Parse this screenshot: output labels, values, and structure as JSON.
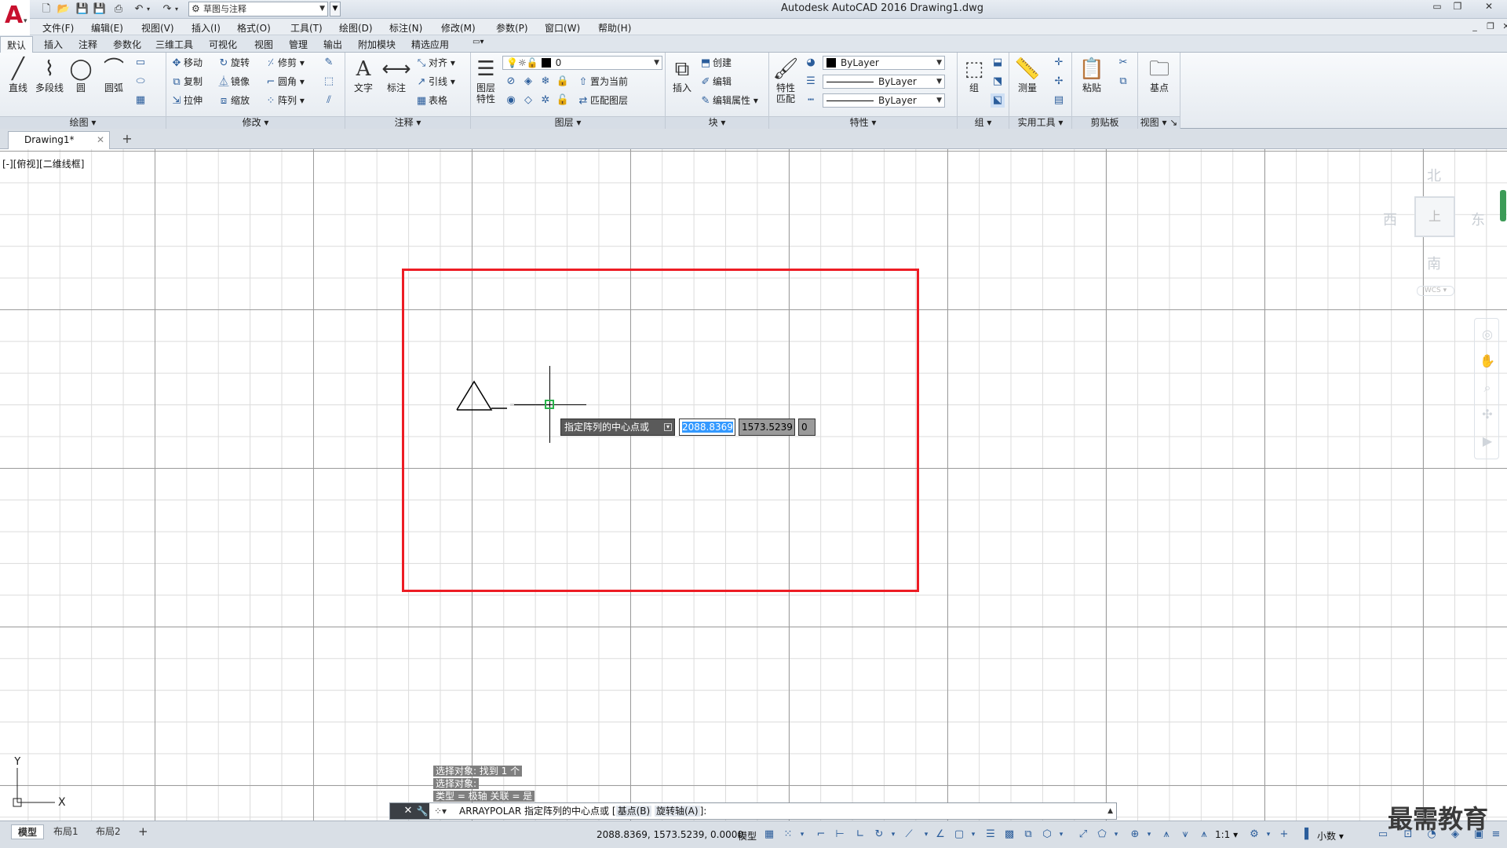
{
  "window": {
    "title": "Autodesk AutoCAD 2016    Drawing1.dwg",
    "workspace": "草图与注释"
  },
  "menu": [
    "文件(F)",
    "编辑(E)",
    "视图(V)",
    "插入(I)",
    "格式(O)",
    "工具(T)",
    "绘图(D)",
    "标注(N)",
    "修改(M)",
    "参数(P)",
    "窗口(W)",
    "帮助(H)"
  ],
  "ribbon_tabs": [
    "默认",
    "插入",
    "注释",
    "参数化",
    "三维工具",
    "可视化",
    "视图",
    "管理",
    "输出",
    "附加模块",
    "精选应用"
  ],
  "ribbon": {
    "draw": {
      "title": "绘图",
      "line": "直线",
      "polyline": "多段线",
      "circle": "圆",
      "arc": "圆弧"
    },
    "modify": {
      "title": "修改",
      "move": "移动",
      "rotate": "旋转",
      "trim": "修剪",
      "copy": "复制",
      "mirror": "镜像",
      "fillet": "圆角",
      "stretch": "拉伸",
      "scale": "缩放",
      "array": "阵列"
    },
    "annotation": {
      "title": "注释",
      "text": "文字",
      "dimension": "标注",
      "align": "对齐",
      "leader": "引线",
      "table": "表格"
    },
    "layers": {
      "title": "图层",
      "props_line1": "图层",
      "props_line2": "特性",
      "current_layer": "0",
      "make_current": "置为当前",
      "match_layer": "匹配图层"
    },
    "block": {
      "title": "块",
      "insert": "插入",
      "create": "创建",
      "edit": "编辑",
      "edit_attributes": "编辑属性"
    },
    "properties": {
      "title": "特性",
      "match_line1": "特性",
      "match_line2": "匹配",
      "color": "ByLayer",
      "linetype": "ByLayer",
      "lineweight": "ByLayer"
    },
    "groups": {
      "title": "组",
      "group": "组"
    },
    "utilities": {
      "title": "实用工具",
      "measure": "测量"
    },
    "clipboard": {
      "title": "剪贴板",
      "paste": "粘贴"
    },
    "view": {
      "title": "视图",
      "base": "基点"
    }
  },
  "document_tab": "Drawing1*",
  "viewport_label": "[-][俯视][二维线框]",
  "dynamic_input": {
    "prompt": "指定阵列的中心点或",
    "x": "2088.8369",
    "y": "1573.5239",
    "z": "0"
  },
  "viewcube": {
    "north": "北",
    "south": "南",
    "east": "东",
    "west": "西",
    "wcs": "WCS"
  },
  "ucs": {
    "x": "X",
    "y": "Y"
  },
  "command_history": [
    "选择对象: 找到 1 个",
    "选择对象:",
    "类型 = 极轴  关联 = 是"
  ],
  "command_line": {
    "command": "ARRAYPOLAR",
    "prompt": "指定阵列的中心点或",
    "bracket_open": "[",
    "option_base": "基点(B)",
    "option_axis": "旋转轴(A)",
    "bracket_close": "]:"
  },
  "layout_tabs": [
    "模型",
    "布局1",
    "布局2"
  ],
  "status": {
    "coordinates": "2088.8369, 1573.5239, 0.0000",
    "space": "模型",
    "annotation_scale": "1:1",
    "units": "小数"
  },
  "watermark": "最需教育",
  "colors": {
    "selection_rect": "#ed1c24",
    "pickbox": "#29b34b",
    "highlight": "#3399ff"
  }
}
